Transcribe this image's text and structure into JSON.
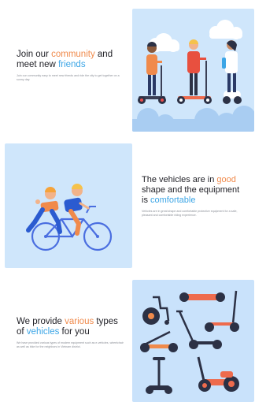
{
  "colors": {
    "accent_orange": "#f08a4b",
    "accent_blue": "#3ba5e6",
    "panel_bg": "#cfe6fb",
    "text_dark": "#1e1e24",
    "text_muted": "#8a8e96"
  },
  "sections": [
    {
      "headline": {
        "part1": "Join our ",
        "part2": "community",
        "part3": " and meet new ",
        "part4": "friends"
      },
      "description": "Join our community easy to meet new friends and ride the city to get together on a sunny day.",
      "illustration": "three-people-riding-scooters"
    },
    {
      "headline": {
        "part1": "The vehicles are in ",
        "part2": "good",
        "part3": " shape and the equipment is ",
        "part4": "comfortable"
      },
      "description": "Vehicles are in great shape and comfortable protective equipment for a safe, pleasant and comfortable riding experience.",
      "illustration": "two-people-on-tandem-bicycle"
    },
    {
      "headline": {
        "part1": "We provide ",
        "part2": "various",
        "part3": " types of ",
        "part4": "vehicles",
        "part5": " for you"
      },
      "description": "We have provided various types of modern equipment such as e-vehicles, wheelchair as well as bike for the neighbors in Vietnam district.",
      "illustration": "assorted-electric-vehicles"
    }
  ]
}
